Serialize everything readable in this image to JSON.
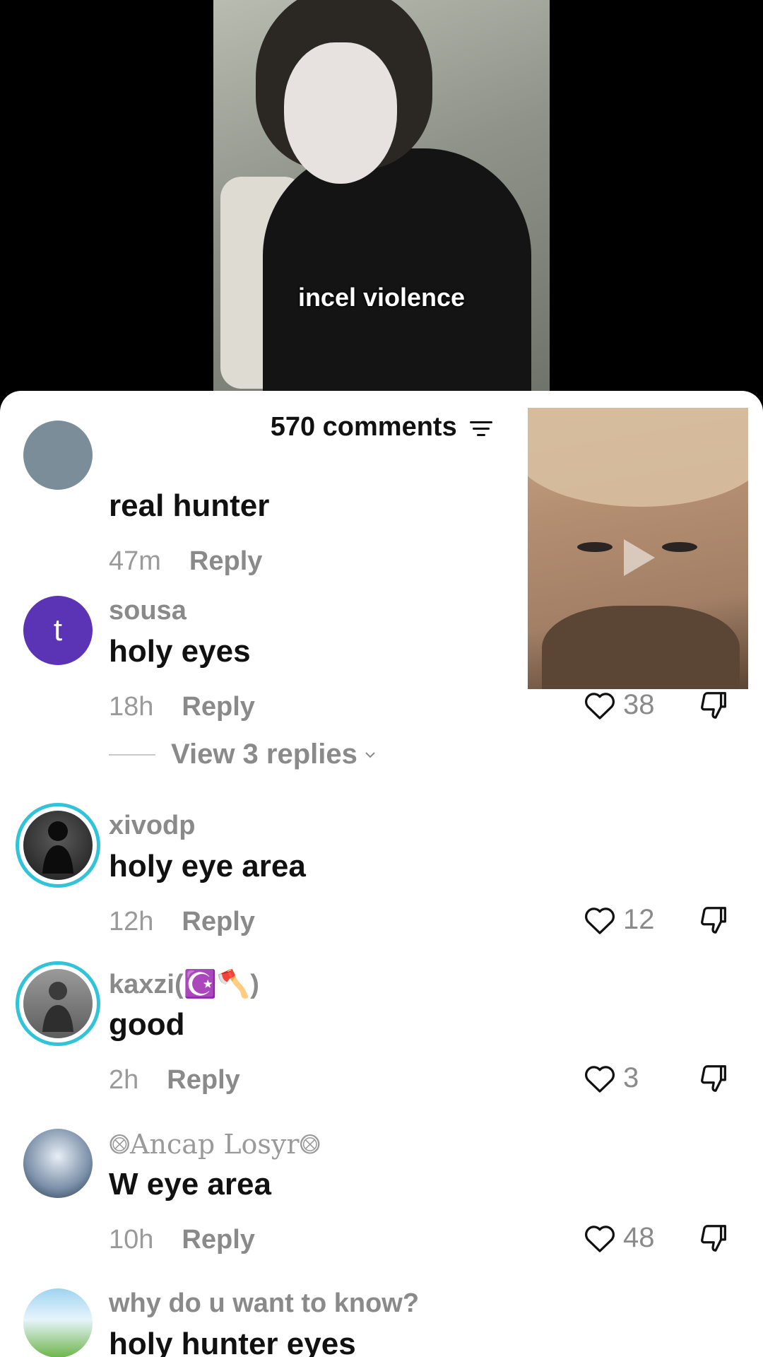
{
  "video": {
    "caption": "incel violence"
  },
  "sheet": {
    "comment_count_label": "570 comments"
  },
  "comments": [
    {
      "username": "",
      "text": "real hunter",
      "time": "47m",
      "reply": "Reply"
    },
    {
      "username": "sousa",
      "avatar_letter": "t",
      "text": "holy eyes",
      "time": "18h",
      "reply": "Reply",
      "likes": "38",
      "view_replies": "View 3 replies"
    },
    {
      "username": "xivodp",
      "text": "holy eye area",
      "time": "12h",
      "reply": "Reply",
      "likes": "12"
    },
    {
      "username": "kaxzi(☪️🪓)",
      "text": "good",
      "time": "2h",
      "reply": "Reply",
      "likes": "3"
    },
    {
      "username": "⨷Ancap Losyr⨷",
      "text": "W eye area",
      "time": "10h",
      "reply": "Reply",
      "likes": "48"
    },
    {
      "username": "why do u want to know?",
      "text": "holy hunter eyes"
    }
  ],
  "colors": {
    "avatar_purple": "#5b34b6",
    "story_ring": "#31c4d9"
  }
}
